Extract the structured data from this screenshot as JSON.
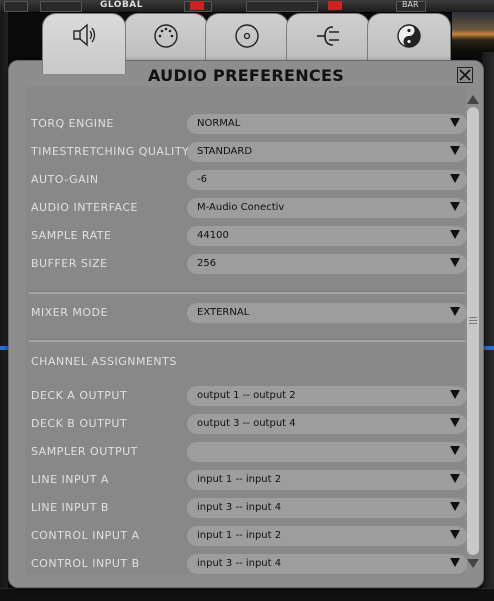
{
  "window": {
    "title": "AUDIO PREFERENCES"
  },
  "background": {
    "global_label": "GLOBAL",
    "bar_label": "BAR"
  },
  "tabs": [
    {
      "name": "audio",
      "icon": "speaker-icon"
    },
    {
      "name": "midi",
      "icon": "midi-icon"
    },
    {
      "name": "disc",
      "icon": "disc-icon"
    },
    {
      "name": "plugin",
      "icon": "plug-icon"
    },
    {
      "name": "other",
      "icon": "yin-yang-icon"
    }
  ],
  "settings": [
    {
      "label": "TORQ ENGINE",
      "value": "NORMAL"
    },
    {
      "label": "TIMESTRETCHING QUALITY",
      "value": "STANDARD"
    },
    {
      "label": "AUTO-GAIN",
      "value": "-6"
    },
    {
      "label": "AUDIO INTERFACE",
      "value": "M-Audio Conectiv"
    },
    {
      "label": "SAMPLE RATE",
      "value": "44100"
    },
    {
      "label": "BUFFER SIZE",
      "value": "256"
    }
  ],
  "mixer": {
    "label": "MIXER MODE",
    "value": "EXTERNAL"
  },
  "channels": {
    "heading": "CHANNEL ASSIGNMENTS",
    "rows": [
      {
        "label": "DECK A OUTPUT",
        "value": "output 1 -- output 2"
      },
      {
        "label": "DECK B OUTPUT",
        "value": "output 3 -- output 4"
      },
      {
        "label": "SAMPLER OUTPUT",
        "value": ""
      },
      {
        "label": "LINE INPUT A",
        "value": "input 1 -- input 2"
      },
      {
        "label": "LINE INPUT B",
        "value": "input 3 -- input 4"
      },
      {
        "label": "CONTROL INPUT A",
        "value": "input 1 -- input 2"
      },
      {
        "label": "CONTROL INPUT B",
        "value": "input 3 -- input 4"
      }
    ]
  },
  "colors": {
    "dialog_bg": "#8d8d8d",
    "select_bg": "#9d9d9d",
    "label_text": "#e0e0e0"
  }
}
